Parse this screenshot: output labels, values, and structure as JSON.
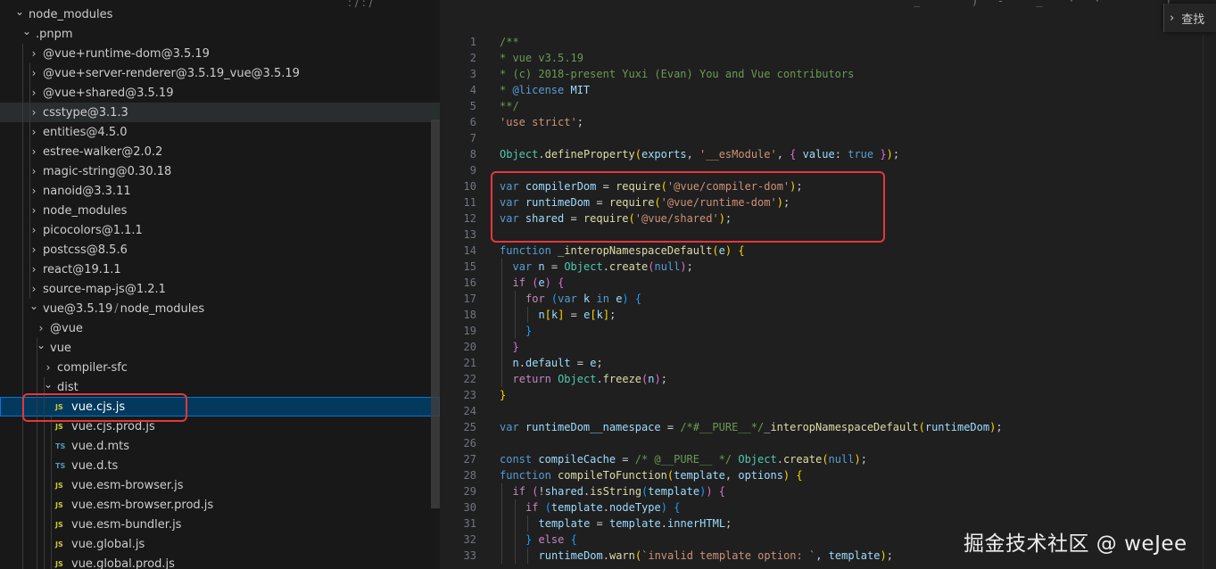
{
  "explorer": {
    "rows": [
      {
        "label": "node_modules",
        "depth": 0,
        "kind": "folder",
        "open": true
      },
      {
        "label": ".pnpm",
        "depth": 1,
        "kind": "folder",
        "open": true
      },
      {
        "label": "@vue+runtime-dom@3.5.19",
        "depth": 2,
        "kind": "folder",
        "open": false
      },
      {
        "label": "@vue+server-renderer@3.5.19_vue@3.5.19",
        "depth": 2,
        "kind": "folder",
        "open": false
      },
      {
        "label": "@vue+shared@3.5.19",
        "depth": 2,
        "kind": "folder",
        "open": false
      },
      {
        "label": "csstype@3.1.3",
        "depth": 2,
        "kind": "folder",
        "open": false,
        "state": "dim"
      },
      {
        "label": "entities@4.5.0",
        "depth": 2,
        "kind": "folder",
        "open": false
      },
      {
        "label": "estree-walker@2.0.2",
        "depth": 2,
        "kind": "folder",
        "open": false
      },
      {
        "label": "magic-string@0.30.18",
        "depth": 2,
        "kind": "folder",
        "open": false
      },
      {
        "label": "nanoid@3.3.11",
        "depth": 2,
        "kind": "folder",
        "open": false
      },
      {
        "label": "node_modules",
        "depth": 2,
        "kind": "folder",
        "open": false
      },
      {
        "label": "picocolors@1.1.1",
        "depth": 2,
        "kind": "folder",
        "open": false
      },
      {
        "label": "postcss@8.5.6",
        "depth": 2,
        "kind": "folder",
        "open": false
      },
      {
        "label": "react@19.1.1",
        "depth": 2,
        "kind": "folder",
        "open": false
      },
      {
        "label": "source-map-js@1.2.1",
        "depth": 2,
        "kind": "folder",
        "open": false
      },
      {
        "label": "vue@3.5.19",
        "label2": "node_modules",
        "depth": 2,
        "kind": "folder",
        "open": true
      },
      {
        "label": "@vue",
        "depth": 3,
        "kind": "folder",
        "open": false
      },
      {
        "label": "vue",
        "depth": 3,
        "kind": "folder",
        "open": true
      },
      {
        "label": "compiler-sfc",
        "depth": 4,
        "kind": "folder",
        "open": false
      },
      {
        "label": "dist",
        "depth": 4,
        "kind": "folder",
        "open": true
      },
      {
        "label": "vue.cjs.js",
        "depth": 5,
        "kind": "js",
        "state": "selected",
        "highlight": true
      },
      {
        "label": "vue.cjs.prod.js",
        "depth": 5,
        "kind": "js"
      },
      {
        "label": "vue.d.mts",
        "depth": 5,
        "kind": "ts"
      },
      {
        "label": "vue.d.ts",
        "depth": 5,
        "kind": "ts"
      },
      {
        "label": "vue.esm-browser.js",
        "depth": 5,
        "kind": "js"
      },
      {
        "label": "vue.esm-browser.prod.js",
        "depth": 5,
        "kind": "js"
      },
      {
        "label": "vue.esm-bundler.js",
        "depth": 5,
        "kind": "js"
      },
      {
        "label": "vue.global.js",
        "depth": 5,
        "kind": "js"
      },
      {
        "label": "vue.global.prod.js",
        "depth": 5,
        "kind": "js"
      }
    ],
    "type_badges": {
      "js": "JS",
      "ts": "TS"
    },
    "path_separator": "/",
    "icons": {
      "expanded": "chevron-down-icon",
      "collapsed": "chevron-right-icon"
    }
  },
  "find_widget": {
    "toggle_icon": "chevron-right-icon",
    "label": "查找"
  },
  "editor": {
    "lines": [
      {
        "n": 1,
        "indent": 0,
        "tokens": [
          [
            "c",
            "/**"
          ]
        ]
      },
      {
        "n": 2,
        "indent": 0,
        "tokens": [
          [
            "c",
            "* vue v3.5.19"
          ]
        ]
      },
      {
        "n": 3,
        "indent": 0,
        "tokens": [
          [
            "c",
            "* (c) 2018-present Yuxi (Evan) You and Vue contributors"
          ]
        ]
      },
      {
        "n": 4,
        "indent": 0,
        "tokens": [
          [
            "c",
            "* "
          ],
          [
            "k",
            "@license"
          ],
          [
            "v",
            " MIT"
          ]
        ]
      },
      {
        "n": 5,
        "indent": 0,
        "tokens": [
          [
            "c",
            "**/"
          ]
        ]
      },
      {
        "n": 6,
        "indent": 0,
        "tokens": [
          [
            "s",
            "'use strict'"
          ],
          [
            "p",
            ";"
          ]
        ]
      },
      {
        "n": 7,
        "indent": 0,
        "tokens": []
      },
      {
        "n": 8,
        "indent": 0,
        "tokens": [
          [
            "t",
            "Object"
          ],
          [
            "p",
            "."
          ],
          [
            "f",
            "defineProperty"
          ],
          [
            "b1",
            "("
          ],
          [
            "v",
            "exports"
          ],
          [
            "p",
            ", "
          ],
          [
            "s",
            "'__esModule'"
          ],
          [
            "p",
            ", "
          ],
          [
            "b2",
            "{"
          ],
          [
            "v",
            " value"
          ],
          [
            "p",
            ": "
          ],
          [
            "k",
            "true"
          ],
          [
            "b2",
            " }"
          ],
          [
            "b1",
            ")"
          ],
          [
            "p",
            ";"
          ]
        ]
      },
      {
        "n": 9,
        "indent": 0,
        "tokens": []
      },
      {
        "n": 10,
        "indent": 0,
        "tokens": [
          [
            "k",
            "var "
          ],
          [
            "v",
            "compilerDom"
          ],
          [
            "p",
            " = "
          ],
          [
            "f",
            "require"
          ],
          [
            "b1",
            "("
          ],
          [
            "s",
            "'@vue/compiler-dom'"
          ],
          [
            "b1",
            ")"
          ],
          [
            "p",
            ";"
          ]
        ]
      },
      {
        "n": 11,
        "indent": 0,
        "tokens": [
          [
            "k",
            "var "
          ],
          [
            "v",
            "runtimeDom"
          ],
          [
            "p",
            " = "
          ],
          [
            "f",
            "require"
          ],
          [
            "b1",
            "("
          ],
          [
            "s",
            "'@vue/runtime-dom'"
          ],
          [
            "b1",
            ")"
          ],
          [
            "p",
            ";"
          ]
        ]
      },
      {
        "n": 12,
        "indent": 0,
        "tokens": [
          [
            "k",
            "var "
          ],
          [
            "v",
            "shared"
          ],
          [
            "p",
            " = "
          ],
          [
            "f",
            "require"
          ],
          [
            "b1",
            "("
          ],
          [
            "s",
            "'@vue/shared'"
          ],
          [
            "b1",
            ")"
          ],
          [
            "p",
            ";"
          ]
        ]
      },
      {
        "n": 13,
        "indent": 0,
        "tokens": []
      },
      {
        "n": 14,
        "indent": 0,
        "tokens": [
          [
            "k",
            "function "
          ],
          [
            "f",
            "_interopNamespaceDefault"
          ],
          [
            "b1",
            "("
          ],
          [
            "v",
            "e"
          ],
          [
            "b1",
            ")"
          ],
          [
            "b1",
            " {"
          ]
        ]
      },
      {
        "n": 15,
        "indent": 1,
        "tokens": [
          [
            "k",
            "var "
          ],
          [
            "v",
            "n"
          ],
          [
            "p",
            " = "
          ],
          [
            "t",
            "Object"
          ],
          [
            "p",
            "."
          ],
          [
            "f",
            "create"
          ],
          [
            "b2",
            "("
          ],
          [
            "k",
            "null"
          ],
          [
            "b2",
            ")"
          ],
          [
            "p",
            ";"
          ]
        ]
      },
      {
        "n": 16,
        "indent": 1,
        "tokens": [
          [
            "x",
            "if "
          ],
          [
            "b2",
            "("
          ],
          [
            "v",
            "e"
          ],
          [
            "b2",
            ")"
          ],
          [
            "b2",
            " {"
          ]
        ]
      },
      {
        "n": 17,
        "indent": 2,
        "tokens": [
          [
            "x",
            "for "
          ],
          [
            "b3",
            "("
          ],
          [
            "k",
            "var "
          ],
          [
            "v",
            "k"
          ],
          [
            "k",
            " in "
          ],
          [
            "v",
            "e"
          ],
          [
            "b3",
            ")"
          ],
          [
            "b3",
            " {"
          ]
        ]
      },
      {
        "n": 18,
        "indent": 3,
        "tokens": [
          [
            "v",
            "n"
          ],
          [
            "b1",
            "["
          ],
          [
            "v",
            "k"
          ],
          [
            "b1",
            "]"
          ],
          [
            "p",
            " = "
          ],
          [
            "v",
            "e"
          ],
          [
            "b1",
            "["
          ],
          [
            "v",
            "k"
          ],
          [
            "b1",
            "]"
          ],
          [
            "p",
            ";"
          ]
        ]
      },
      {
        "n": 19,
        "indent": 2,
        "tokens": [
          [
            "b3",
            "}"
          ]
        ]
      },
      {
        "n": 20,
        "indent": 1,
        "tokens": [
          [
            "b2",
            "}"
          ]
        ]
      },
      {
        "n": 21,
        "indent": 1,
        "tokens": [
          [
            "v",
            "n"
          ],
          [
            "p",
            "."
          ],
          [
            "v",
            "default"
          ],
          [
            "p",
            " = "
          ],
          [
            "v",
            "e"
          ],
          [
            "p",
            ";"
          ]
        ]
      },
      {
        "n": 22,
        "indent": 1,
        "tokens": [
          [
            "x",
            "return "
          ],
          [
            "t",
            "Object"
          ],
          [
            "p",
            "."
          ],
          [
            "f",
            "freeze"
          ],
          [
            "b2",
            "("
          ],
          [
            "v",
            "n"
          ],
          [
            "b2",
            ")"
          ],
          [
            "p",
            ";"
          ]
        ]
      },
      {
        "n": 23,
        "indent": 0,
        "tokens": [
          [
            "b1",
            "}"
          ]
        ]
      },
      {
        "n": 24,
        "indent": 0,
        "tokens": []
      },
      {
        "n": 25,
        "indent": 0,
        "tokens": [
          [
            "k",
            "var "
          ],
          [
            "v",
            "runtimeDom__namespace"
          ],
          [
            "p",
            " = "
          ],
          [
            "c",
            "/*#__PURE__*/"
          ],
          [
            "f",
            "_interopNamespaceDefault"
          ],
          [
            "b1",
            "("
          ],
          [
            "v",
            "runtimeDom"
          ],
          [
            "b1",
            ")"
          ],
          [
            "p",
            ";"
          ]
        ]
      },
      {
        "n": 26,
        "indent": 0,
        "tokens": []
      },
      {
        "n": 27,
        "indent": 0,
        "tokens": [
          [
            "k",
            "const "
          ],
          [
            "v",
            "compileCache"
          ],
          [
            "p",
            " = "
          ],
          [
            "c",
            "/* @__PURE__ */"
          ],
          [
            "p",
            " "
          ],
          [
            "t",
            "Object"
          ],
          [
            "p",
            "."
          ],
          [
            "f",
            "create"
          ],
          [
            "b1",
            "("
          ],
          [
            "k",
            "null"
          ],
          [
            "b1",
            ")"
          ],
          [
            "p",
            ";"
          ]
        ]
      },
      {
        "n": 28,
        "indent": 0,
        "tokens": [
          [
            "k",
            "function "
          ],
          [
            "f",
            "compileToFunction"
          ],
          [
            "b1",
            "("
          ],
          [
            "v",
            "template"
          ],
          [
            "p",
            ", "
          ],
          [
            "v",
            "options"
          ],
          [
            "b1",
            ")"
          ],
          [
            "b1",
            " {"
          ]
        ]
      },
      {
        "n": 29,
        "indent": 1,
        "tokens": [
          [
            "x",
            "if "
          ],
          [
            "b2",
            "("
          ],
          [
            "p",
            "!"
          ],
          [
            "v",
            "shared"
          ],
          [
            "p",
            "."
          ],
          [
            "f",
            "isString"
          ],
          [
            "b3",
            "("
          ],
          [
            "v",
            "template"
          ],
          [
            "b3",
            ")"
          ],
          [
            "b2",
            ")"
          ],
          [
            "b2",
            " {"
          ]
        ]
      },
      {
        "n": 30,
        "indent": 2,
        "tokens": [
          [
            "x",
            "if "
          ],
          [
            "b3",
            "("
          ],
          [
            "v",
            "template"
          ],
          [
            "p",
            "."
          ],
          [
            "v",
            "nodeType"
          ],
          [
            "b3",
            ")"
          ],
          [
            "b3",
            " {"
          ]
        ]
      },
      {
        "n": 31,
        "indent": 3,
        "tokens": [
          [
            "v",
            "template"
          ],
          [
            "p",
            " = "
          ],
          [
            "v",
            "template"
          ],
          [
            "p",
            "."
          ],
          [
            "v",
            "innerHTML"
          ],
          [
            "p",
            ";"
          ]
        ]
      },
      {
        "n": 32,
        "indent": 2,
        "tokens": [
          [
            "b3",
            "}"
          ],
          [
            "x",
            " else "
          ],
          [
            "b3",
            "{"
          ]
        ]
      },
      {
        "n": 33,
        "indent": 3,
        "tokens": [
          [
            "v",
            "runtimeDom"
          ],
          [
            "p",
            "."
          ],
          [
            "f",
            "warn"
          ],
          [
            "b1",
            "("
          ],
          [
            "s",
            "`invalid template option: `"
          ],
          [
            "p",
            ", "
          ],
          [
            "v",
            "template"
          ],
          [
            "b1",
            ")"
          ],
          [
            "p",
            ";"
          ]
        ]
      }
    ],
    "highlighted_range": [
      10,
      12
    ]
  },
  "watermark": "掘金技术社区 @ weJee"
}
